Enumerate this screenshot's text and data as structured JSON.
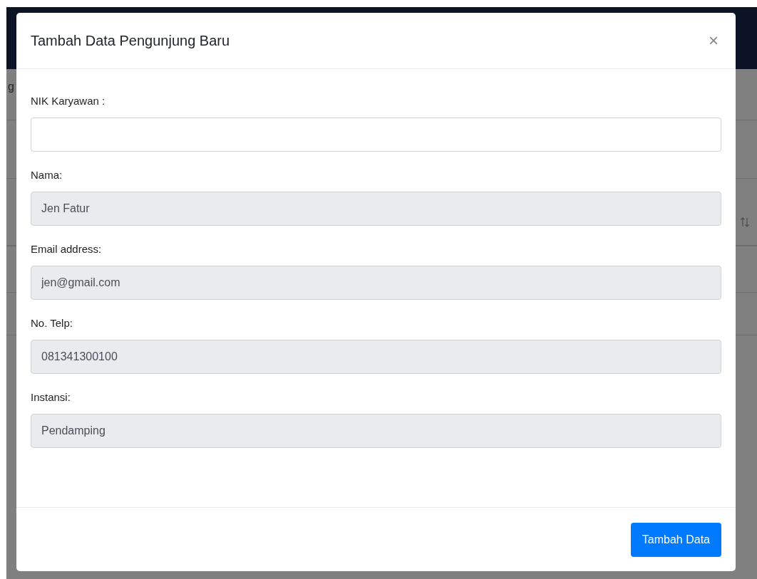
{
  "background": {
    "text_fragment": "g"
  },
  "modal": {
    "title": "Tambah Data Pengunjung Baru",
    "close": "×",
    "fields": [
      {
        "label": "NIK Karyawan :",
        "disabled": false
      },
      {
        "label": "Nama:",
        "value": "Jen Fatur",
        "disabled": true
      },
      {
        "label": "Email address:",
        "value": "jen@gmail.com",
        "disabled": true
      },
      {
        "label": "No. Telp:",
        "value": "081341300100",
        "disabled": true
      },
      {
        "label": "Instansi:",
        "value": "Pendamping",
        "disabled": true
      }
    ],
    "submit": "Tambah Data"
  }
}
